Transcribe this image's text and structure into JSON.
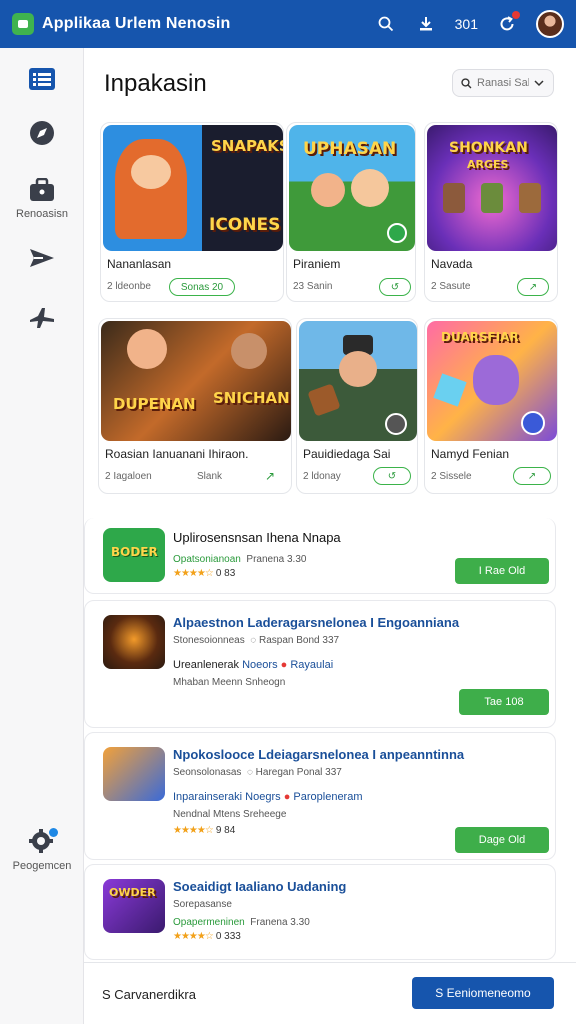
{
  "header": {
    "app_title": "Applikaa Urlem Nenosin",
    "count": "301",
    "icons": [
      "logo-icon",
      "search-icon",
      "download-icon",
      "refresh-icon",
      "avatar"
    ]
  },
  "sidebar": {
    "items": [
      {
        "icon": "list-icon",
        "label": ""
      },
      {
        "icon": "compass-icon",
        "label": ""
      },
      {
        "icon": "briefcase-icon",
        "label": "Renoasisn"
      },
      {
        "icon": "send-icon",
        "label": ""
      },
      {
        "icon": "plane-icon",
        "label": ""
      }
    ],
    "settings_label": "Peogemcen"
  },
  "main": {
    "title": "Inpakasin",
    "search": {
      "placeholder": "Ranasi Sal"
    }
  },
  "cards": [
    {
      "title": "Nananlasan",
      "meta": "2 ldeonbe",
      "action": "Sonas 20",
      "art_line1": "SNAPAKS",
      "art_line2": "ICONES"
    },
    {
      "title": "Piraniem",
      "meta": "23 Sanin",
      "action": "",
      "art_line1": "UPHASAN",
      "art_line2": ""
    },
    {
      "title": "Navada",
      "meta": "2 Sasute",
      "action": "",
      "art_line1": "SHONKAN",
      "art_line2": "ARGES"
    },
    {
      "title": "Roasian Ianuanani Ihiraon.",
      "meta": "2 Iagaloen",
      "meta2": "Slank",
      "action": "",
      "art_line1": "DUPENAN",
      "art_line2": "SNICHAN"
    },
    {
      "title": "Pauidiedaga Sai",
      "meta": "2 ldonay",
      "action": "",
      "art_line1": "",
      "art_line2": ""
    },
    {
      "title": "Namyd Fenian",
      "meta": "2 Sissele",
      "action": "",
      "art_line1": "DUARSFIAR",
      "art_line2": ""
    }
  ],
  "list": [
    {
      "title": "Uplirosensnsan Ihena Nnapa",
      "sub": "Opatsonianoan",
      "sub2": "Pranena 3.30",
      "rating": "0 83",
      "button": "I Rae Old",
      "art": "BODER"
    },
    {
      "title": "Alpaestnon Laderagarsnelonea I Engoanniana",
      "sub": "Stonesoionneas",
      "sub2": "Raspan Bond 337",
      "line1_a": "Ureanlenerak",
      "line1_b": "Noeors",
      "line1_c": "Rayaulai",
      "line2": "Mhaban Meenn Snheogn",
      "button": "Tae 108"
    },
    {
      "title": "Npokoslooce Ldeiagarsnelonea I anpeanntinna",
      "sub": "Seonsolonasas",
      "sub2": "Haregan Ponal 337",
      "line1_a": "Inparainseraki",
      "line1_b": "Noegrs",
      "line1_c": "Paropleneram",
      "line2": "Nendnal Mtens Sreheege",
      "rating": "9 84",
      "button": "Dage Old"
    },
    {
      "title": "Soeaidigt Iaaliano Uadaning",
      "sub": "Sorepasanse",
      "sub2": "",
      "line1": "Opapermeninen",
      "line1_b": "Franena 3.30",
      "rating": "0 333",
      "button": "",
      "art": "OWDER"
    }
  ],
  "footer": {
    "text": "S Carvanerdikra",
    "button": "S Eeniomeneomo"
  },
  "colors": {
    "primary": "#1655ad",
    "green": "#3eae4a",
    "star": "#f2a11a"
  }
}
